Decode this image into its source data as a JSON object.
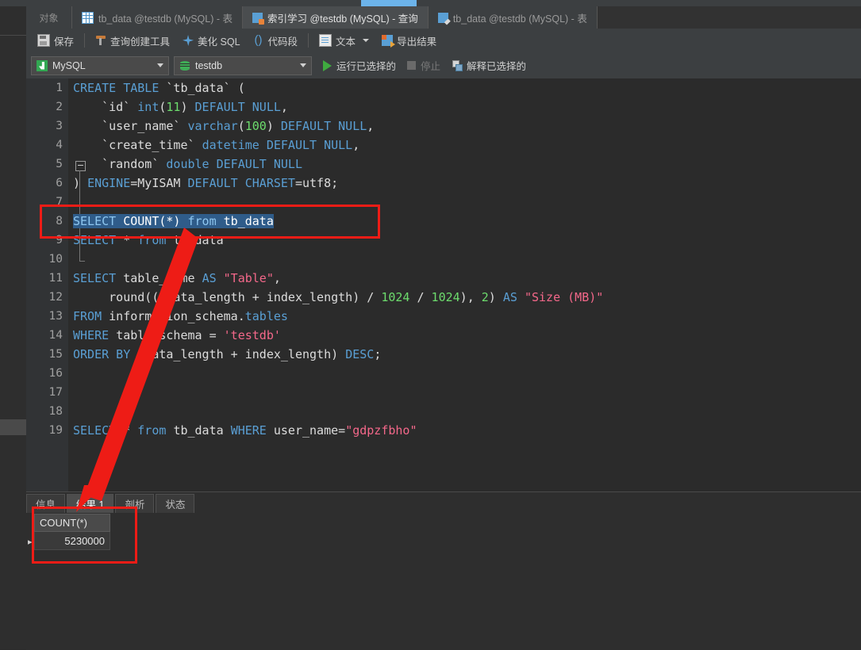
{
  "app": {
    "theme_bg": "#2b2b2b",
    "accent": "#5a9fd4",
    "annotation_color": "#ee1c16"
  },
  "tabbar": {
    "objects_label": "对象",
    "tabs": [
      {
        "label": "tb_data @testdb (MySQL) - 表",
        "icon": "table-grid-icon",
        "active": false
      },
      {
        "label": "索引学习 @testdb (MySQL) - 查询",
        "icon": "query-icon",
        "active": true
      },
      {
        "label": "tb_data @testdb (MySQL) - 表",
        "icon": "table-edit-icon",
        "active": false
      }
    ]
  },
  "toolbar": {
    "save_label": "保存",
    "query_builder_label": "查询创建工具",
    "beautify_label": "美化 SQL",
    "snippet_label": "代码段",
    "text_label": "文本",
    "export_label": "导出结果"
  },
  "toolbar2": {
    "connection": {
      "value": "MySQL",
      "icon": "mysql-logo-icon"
    },
    "database": {
      "value": "testdb",
      "icon": "database-icon"
    },
    "run_selected_label": "运行已选择的",
    "stop_label": "停止",
    "explain_selected_label": "解释已选择的"
  },
  "editor": {
    "selection_text": "SELECT COUNT(*) from tb_data",
    "lines": [
      {
        "n": 1,
        "tokens": [
          {
            "t": "CREATE TABLE ",
            "c": "kw"
          },
          {
            "t": "`tb_data` (",
            "c": "pln"
          }
        ]
      },
      {
        "n": 2,
        "tokens": [
          {
            "t": "    `id` ",
            "c": "pln"
          },
          {
            "t": "int",
            "c": "kw"
          },
          {
            "t": "(",
            "c": "pln"
          },
          {
            "t": "11",
            "c": "num"
          },
          {
            "t": ") ",
            "c": "pln"
          },
          {
            "t": "DEFAULT NULL",
            "c": "kw"
          },
          {
            "t": ",",
            "c": "pln"
          }
        ]
      },
      {
        "n": 3,
        "tokens": [
          {
            "t": "    `user_name` ",
            "c": "pln"
          },
          {
            "t": "varchar",
            "c": "kw"
          },
          {
            "t": "(",
            "c": "pln"
          },
          {
            "t": "100",
            "c": "num"
          },
          {
            "t": ") ",
            "c": "pln"
          },
          {
            "t": "DEFAULT NULL",
            "c": "kw"
          },
          {
            "t": ",",
            "c": "pln"
          }
        ]
      },
      {
        "n": 4,
        "tokens": [
          {
            "t": "    `create_time` ",
            "c": "pln"
          },
          {
            "t": "datetime DEFAULT NULL",
            "c": "kw"
          },
          {
            "t": ",",
            "c": "pln"
          }
        ]
      },
      {
        "n": 5,
        "tokens": [
          {
            "t": "    `random` ",
            "c": "pln"
          },
          {
            "t": "double DEFAULT NULL",
            "c": "kw"
          }
        ]
      },
      {
        "n": 6,
        "tokens": [
          {
            "t": ") ",
            "c": "pln"
          },
          {
            "t": "ENGINE",
            "c": "kw"
          },
          {
            "t": "=MyISAM ",
            "c": "pln"
          },
          {
            "t": "DEFAULT CHARSET",
            "c": "kw"
          },
          {
            "t": "=utf8;",
            "c": "pln"
          }
        ]
      },
      {
        "n": 7,
        "tokens": []
      },
      {
        "n": 8,
        "selected": true,
        "tokens": [
          {
            "t": "SELECT ",
            "c": "kw"
          },
          {
            "t": "COUNT(*) ",
            "c": "pln"
          },
          {
            "t": "from ",
            "c": "kw"
          },
          {
            "t": "tb_data",
            "c": "pln"
          }
        ]
      },
      {
        "n": 9,
        "tokens": [
          {
            "t": "SELECT ",
            "c": "kw"
          },
          {
            "t": "* ",
            "c": "pln"
          },
          {
            "t": "from ",
            "c": "kw"
          },
          {
            "t": "tb_data",
            "c": "pln"
          }
        ]
      },
      {
        "n": 10,
        "tokens": []
      },
      {
        "n": 11,
        "tokens": [
          {
            "t": "SELECT ",
            "c": "kw"
          },
          {
            "t": "table_name ",
            "c": "pln"
          },
          {
            "t": "AS ",
            "c": "kw"
          },
          {
            "t": "\"Table\"",
            "c": "str"
          },
          {
            "t": ",",
            "c": "pln"
          }
        ]
      },
      {
        "n": 12,
        "tokens": [
          {
            "t": "     round(((data_length + index_length) / ",
            "c": "pln"
          },
          {
            "t": "1024",
            "c": "num"
          },
          {
            "t": " / ",
            "c": "pln"
          },
          {
            "t": "1024",
            "c": "num"
          },
          {
            "t": "), ",
            "c": "pln"
          },
          {
            "t": "2",
            "c": "num"
          },
          {
            "t": ") ",
            "c": "pln"
          },
          {
            "t": "AS ",
            "c": "kw"
          },
          {
            "t": "\"Size (MB)\"",
            "c": "str"
          }
        ]
      },
      {
        "n": 13,
        "tokens": [
          {
            "t": "FROM ",
            "c": "kw"
          },
          {
            "t": "information_schema.",
            "c": "pln"
          },
          {
            "t": "tables",
            "c": "kw"
          }
        ]
      },
      {
        "n": 14,
        "tokens": [
          {
            "t": "WHERE ",
            "c": "kw"
          },
          {
            "t": "table_schema = ",
            "c": "pln"
          },
          {
            "t": "'testdb'",
            "c": "str"
          }
        ]
      },
      {
        "n": 15,
        "tokens": [
          {
            "t": "ORDER BY ",
            "c": "kw"
          },
          {
            "t": "(data_length + index_length) ",
            "c": "pln"
          },
          {
            "t": "DESC",
            "c": "kw"
          },
          {
            "t": ";",
            "c": "pln"
          }
        ]
      },
      {
        "n": 16,
        "tokens": []
      },
      {
        "n": 17,
        "tokens": []
      },
      {
        "n": 18,
        "tokens": []
      },
      {
        "n": 19,
        "tokens": [
          {
            "t": "SELECT ",
            "c": "kw"
          },
          {
            "t": "* ",
            "c": "pln"
          },
          {
            "t": "from ",
            "c": "kw"
          },
          {
            "t": "tb_data ",
            "c": "pln"
          },
          {
            "t": "WHERE ",
            "c": "kw"
          },
          {
            "t": "user_name=",
            "c": "pln"
          },
          {
            "t": "\"gdpzfbho\"",
            "c": "str"
          }
        ]
      }
    ]
  },
  "results": {
    "tabs": [
      {
        "label": "信息",
        "active": false
      },
      {
        "label": "结果 1",
        "active": true
      },
      {
        "label": "剖析",
        "active": false
      },
      {
        "label": "状态",
        "active": false
      }
    ],
    "grid": {
      "columns": [
        "COUNT(*)"
      ],
      "rows": [
        [
          "5230000"
        ]
      ],
      "row_marker": "▸"
    }
  }
}
